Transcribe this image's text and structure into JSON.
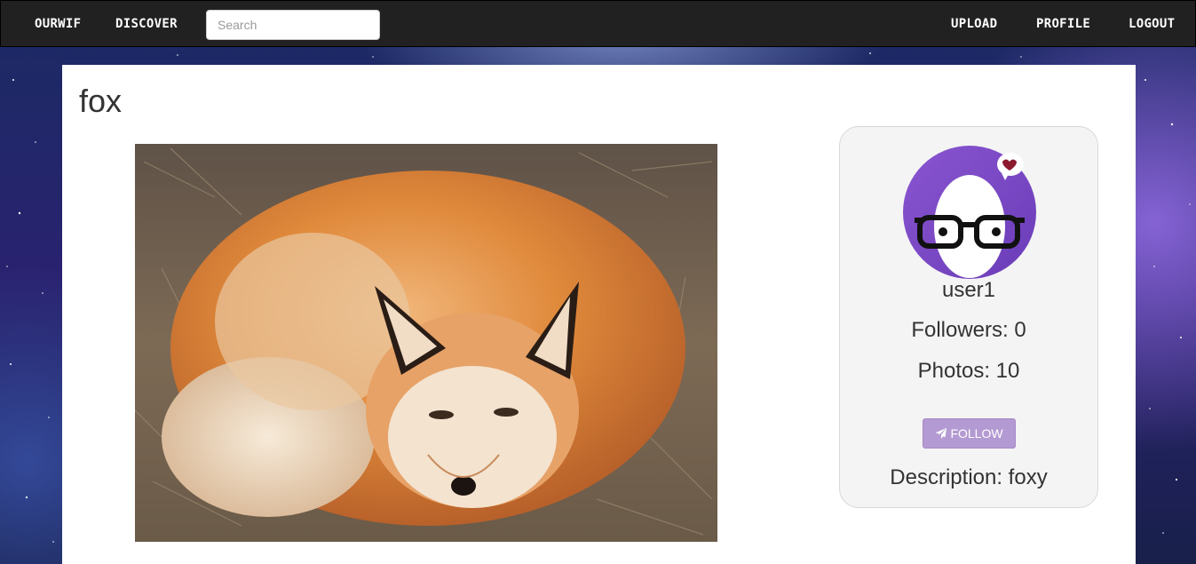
{
  "nav": {
    "brand": "OURWIF",
    "discover": "DISCOVER",
    "search_placeholder": "Search",
    "upload": "UPLOAD",
    "profile": "PROFILE",
    "logout": "LOGOUT"
  },
  "post": {
    "title": "fox",
    "image_alt": "fox"
  },
  "profile": {
    "username": "user1",
    "followers": "Followers: 0",
    "photos": "Photos: 10",
    "follow_label": "FOLLOW",
    "follow_icon": "paper-plane-icon",
    "description": "Description: foxy"
  },
  "colors": {
    "navbar": "#212121",
    "follow_button": "#b49ad2",
    "avatar_purple": "#7b4cc4"
  }
}
